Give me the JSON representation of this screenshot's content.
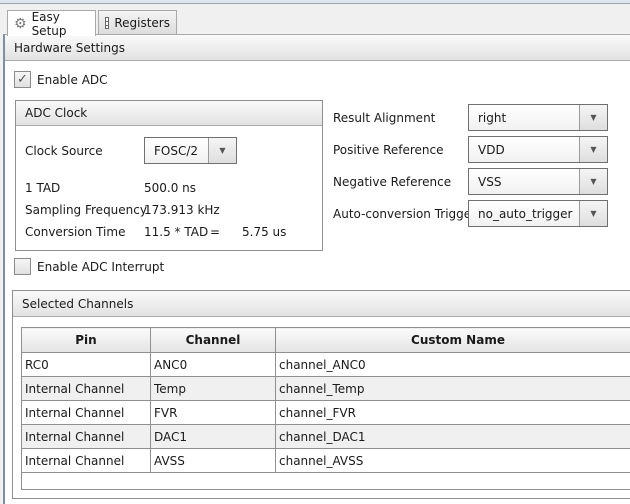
{
  "tabs": [
    {
      "label": "Easy Setup",
      "icon": "gear-icon",
      "active": true
    },
    {
      "label": "Registers",
      "icon": "list-icon",
      "active": false
    }
  ],
  "section_title": "Hardware Settings",
  "enable_adc": {
    "label": "Enable ADC",
    "checked": true
  },
  "adc_clock": {
    "title": "ADC Clock",
    "clock_source_label": "Clock Source",
    "clock_source_value": "FOSC/2",
    "tad_label": "1 TAD",
    "tad_value": "500.0 ns",
    "sampling_label": "Sampling Frequency",
    "sampling_value": "173.913 kHz",
    "conversion_label": "Conversion Time",
    "conversion_formula": "11.5 * TAD",
    "conversion_eq": "=",
    "conversion_value": "5.75 us"
  },
  "enable_interrupt": {
    "label": "Enable ADC Interrupt",
    "checked": false
  },
  "settings": [
    {
      "label": "Result Alignment",
      "value": "right"
    },
    {
      "label": "Positive Reference",
      "value": "VDD"
    },
    {
      "label": "Negative Reference",
      "value": "VSS"
    },
    {
      "label": "Auto-conversion Trigger",
      "value": "no_auto_trigger"
    }
  ],
  "channels": {
    "title": "Selected Channels",
    "columns": [
      "Pin",
      "Channel",
      "Custom Name"
    ],
    "rows": [
      [
        "RC0",
        "ANC0",
        "channel_ANC0"
      ],
      [
        "Internal Channel",
        "Temp",
        "channel_Temp"
      ],
      [
        "Internal Channel",
        "FVR",
        "channel_FVR"
      ],
      [
        "Internal Channel",
        "DAC1",
        "channel_DAC1"
      ],
      [
        "Internal Channel",
        "AVSS",
        "channel_AVSS"
      ]
    ]
  }
}
